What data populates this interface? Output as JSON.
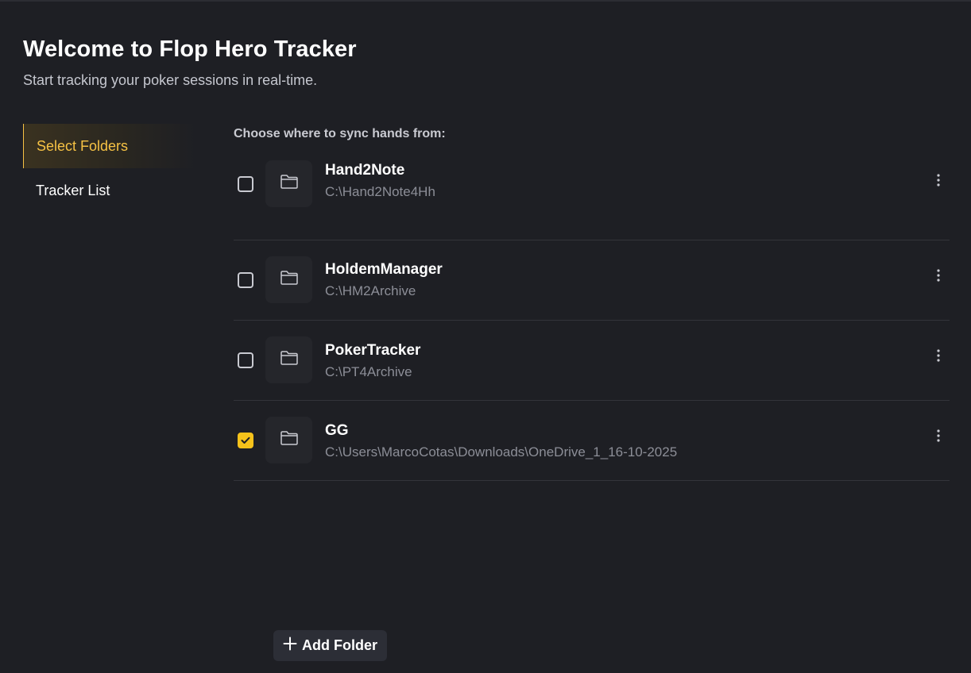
{
  "header": {
    "title": "Welcome to Flop Hero Tracker",
    "subtitle": "Start tracking your poker sessions in real-time."
  },
  "sidebar": {
    "items": [
      {
        "label": "Select Folders",
        "active": true
      },
      {
        "label": "Tracker List",
        "active": false
      }
    ]
  },
  "main": {
    "section_label": "Choose where to sync hands from:",
    "folders": [
      {
        "name": "Hand2Note",
        "path": "C:\\Hand2Note4Hh",
        "checked": false,
        "icon": "folder-icon"
      },
      {
        "name": "HoldemManager",
        "path": "C:\\HM2Archive",
        "checked": false,
        "icon": "folder-icon"
      },
      {
        "name": "PokerTracker",
        "path": "C:\\PT4Archive",
        "checked": false,
        "icon": "folder-icon"
      },
      {
        "name": "GG",
        "path": "C:\\Users\\MarcoCotas\\Downloads\\OneDrive_1_16-10-2025",
        "checked": true,
        "icon": "folder-icon"
      }
    ],
    "add_folder_label": "Add Folder"
  },
  "colors": {
    "accent": "#f6c244",
    "checkbox_checked": "#f6c21b",
    "background": "#1e1f24"
  }
}
